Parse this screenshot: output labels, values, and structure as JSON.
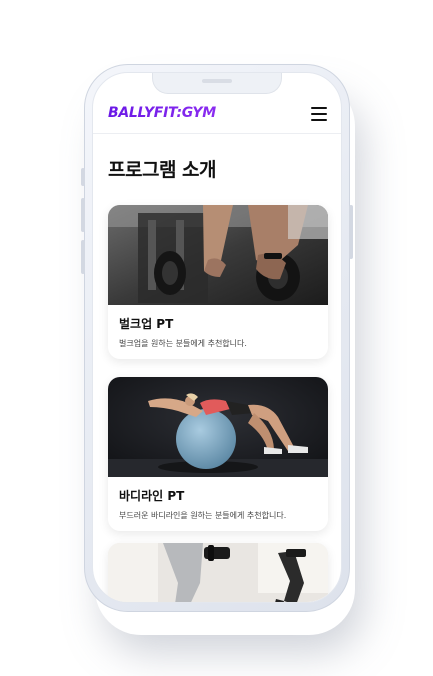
{
  "header": {
    "logo": "BALLYFIT:GYM",
    "menu_icon": "hamburger-menu-icon"
  },
  "page": {
    "title": "프로그램 소개"
  },
  "programs": [
    {
      "title": "벌크업 PT",
      "description": "벌크업을 원하는 분들에게 추천합니다."
    },
    {
      "title": "바디라인 PT",
      "description": "부드러운 바디라인을 원하는 분들에게 추천합니다."
    }
  ],
  "colors": {
    "logo_start": "#6a18e6",
    "logo_end": "#8b2cf0",
    "title": "#111111"
  }
}
